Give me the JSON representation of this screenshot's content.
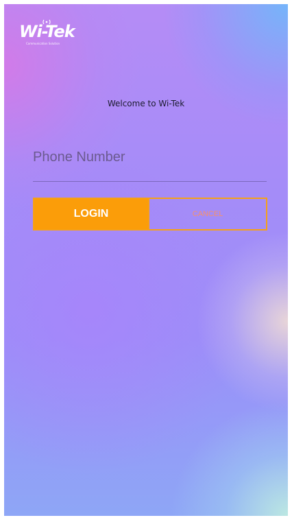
{
  "brand": {
    "wordmark": "Wi-Tek",
    "tagline": "Communication Solution",
    "logo_color": "#ffffff"
  },
  "welcome": {
    "text": "Welcome to Wi-Tek"
  },
  "login_form": {
    "phone_placeholder": "Phone Number",
    "phone_value": "",
    "login_label": "LOGIN",
    "cancel_label": "CANCEL"
  },
  "colors": {
    "accent": "#fb9d09",
    "cancel_text": "#f6916b",
    "gradient_top": "#b58cf6",
    "gradient_bottom": "#8ea6f6"
  }
}
